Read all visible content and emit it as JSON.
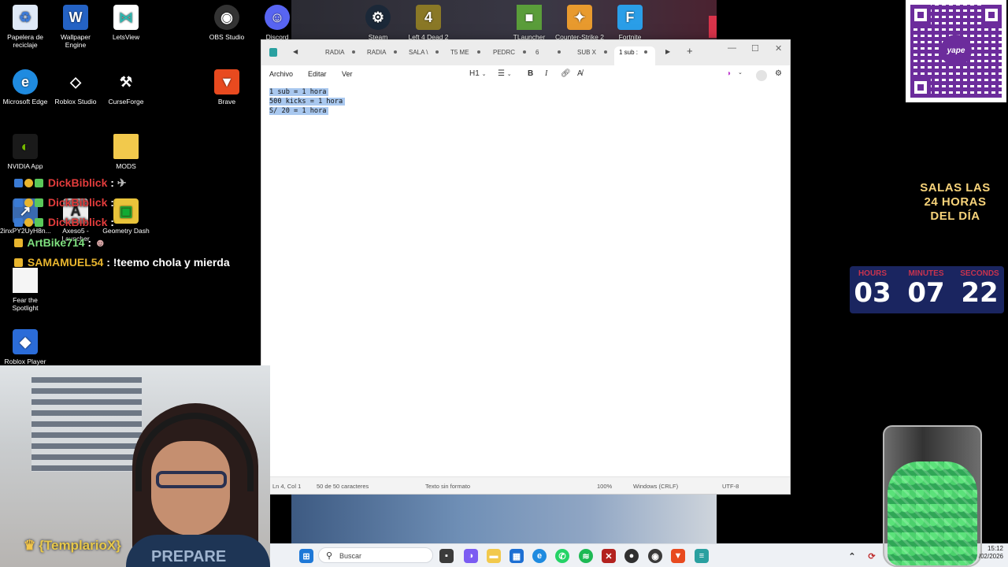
{
  "desktop": {
    "icons": [
      {
        "label": "Papelera de reciclaje",
        "icon": "recycle-bin-icon",
        "color": "#3d7bd8"
      },
      {
        "label": "Wallpaper Engine",
        "icon": "wallpaper-engine-icon",
        "color": "#2462c4"
      },
      {
        "label": "LetsView",
        "icon": "letsview-icon",
        "color": "#2fb7b0"
      },
      {
        "label": "OBS Studio",
        "icon": "obs-icon",
        "color": "#2b2b2b"
      },
      {
        "label": "Discord",
        "icon": "discord-icon",
        "color": "#5865f2"
      },
      {
        "label": "Steam",
        "icon": "steam-icon",
        "color": "#1b2838"
      },
      {
        "label": "Left 4 Dead 2",
        "icon": "l4d2-icon",
        "color": "#a08a2a"
      },
      {
        "label": "TLauncher",
        "icon": "tlauncher-icon",
        "color": "#5a9d3a"
      },
      {
        "label": "Counter-Strike 2",
        "icon": "cs2-icon",
        "color": "#e89a2e"
      },
      {
        "label": "Fortnite",
        "icon": "fortnite-icon",
        "color": "#2a9ee8"
      },
      {
        "label": "Microsoft Edge",
        "icon": "edge-icon",
        "color": "#1f8be0"
      },
      {
        "label": "Roblox Studio",
        "icon": "roblox-studio-icon",
        "color": "#222"
      },
      {
        "label": "CurseForge",
        "icon": "curseforge-icon",
        "color": "#111"
      },
      {
        "label": "Brave",
        "icon": "brave-icon",
        "color": "#e84a1f"
      },
      {
        "label": "NVIDIA App",
        "icon": "nvidia-icon",
        "color": "#76b900"
      },
      {
        "label": "MODS",
        "icon": "folder-icon",
        "color": "#f2c94c"
      },
      {
        "label": "2inxPY2UyH8n...",
        "icon": "shortcut-icon",
        "color": "#3a6ab0"
      },
      {
        "label": "Axeso5 - Launcher",
        "icon": "axeso5-icon",
        "color": "#eee"
      },
      {
        "label": "Geometry Dash",
        "icon": "geometry-dash-icon",
        "color": "#e9c33a"
      },
      {
        "label": "Fear the Spotlight",
        "icon": "file-icon",
        "color": "#f5f5f5"
      },
      {
        "label": "Roblox Player",
        "icon": "roblox-player-icon",
        "color": "#2b6cd8"
      }
    ]
  },
  "chat": [
    {
      "user": "DickBiblick",
      "sep": " :",
      "msg": "",
      "color": "#e23c3c"
    },
    {
      "user": "DickBiblick",
      "sep": " :",
      "msg": "",
      "color": "#e23c3c"
    },
    {
      "user": "DickBiblick",
      "sep": " :",
      "msg": "",
      "color": "#e23c3c"
    },
    {
      "user": "ArtBike714",
      "sep": " :",
      "msg": "",
      "color": "#7fe07f"
    },
    {
      "user": "SAMAMUEL54",
      "sep": " :",
      "msg": " !teemo chola y mierda",
      "color": "#e8b52e"
    }
  ],
  "notepad": {
    "tabs": [
      "RADIA",
      "RADIA",
      "SALA \\",
      "T5 ME",
      "PEDRC",
      "6",
      "SUB X",
      "1 sub :"
    ],
    "menu": [
      "Archivo",
      "Editar",
      "Ver"
    ],
    "toolbar": {
      "heading": "H1",
      "bold": "B",
      "italic": "I"
    },
    "lines": [
      "1 sub = 1 hora",
      "500 kicks = 1 hora",
      "S/ 20 = 1 hora"
    ],
    "status": {
      "position": "Ln 4, Col 1",
      "chars": "50 de 50 caracteres",
      "format": "Texto sin formato",
      "zoom": "100%",
      "eol": "Windows (CRLF)",
      "encoding": "UTF-8"
    }
  },
  "overlay": {
    "salas": [
      "SALAS LAS",
      "24 HORAS",
      "DEL DÍA"
    ],
    "timer": [
      {
        "label": "HOURS",
        "value": "03"
      },
      {
        "label": "MINUTES",
        "value": "07"
      },
      {
        "label": "SECONDS",
        "value": "22"
      }
    ],
    "qr_brand": "yape"
  },
  "webcam": {
    "name": "{TemplarioX}",
    "shirt": "PREPARE"
  },
  "taskbar": {
    "search_placeholder": "Buscar",
    "time": "15:12",
    "date": "/02/2026"
  }
}
